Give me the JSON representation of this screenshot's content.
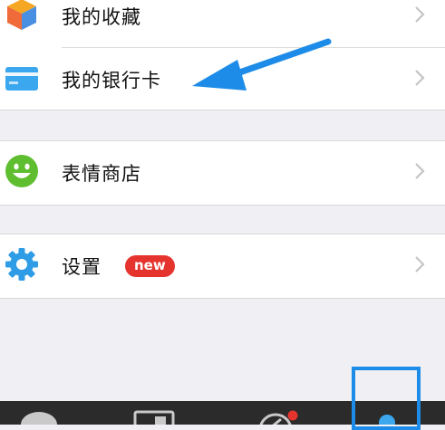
{
  "menu": {
    "favorites": {
      "label": "我的收藏",
      "icon": "cube-icon"
    },
    "bank_card": {
      "label": "我的银行卡",
      "icon": "card-icon"
    },
    "sticker_store": {
      "label": "表情商店",
      "icon": "smiley-icon"
    },
    "settings": {
      "label": "设置",
      "icon": "gear-icon",
      "badge": "new"
    }
  },
  "tabbar": {
    "tabs": [
      {
        "icon": "chat-icon"
      },
      {
        "icon": "contacts-icon"
      },
      {
        "icon": "discover-icon",
        "has_dot": true
      },
      {
        "icon": "me-icon",
        "active": true
      }
    ]
  },
  "colors": {
    "accent_blue": "#1d8ce8",
    "badge_red": "#e5342d",
    "smiley_green": "#5fbe2f",
    "card_blue": "#3aa7ee",
    "gear_blue": "#2e9de6"
  }
}
